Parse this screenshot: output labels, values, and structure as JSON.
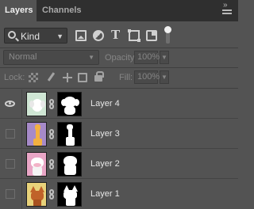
{
  "tabs": [
    {
      "label": "Layers",
      "active": true
    },
    {
      "label": "Channels",
      "active": false
    }
  ],
  "filter": {
    "kind_label": "Kind",
    "icons": [
      "image-filter-icon",
      "adjustment-filter-icon",
      "type-filter-icon",
      "shape-filter-icon",
      "smart-object-filter-icon",
      "filter-toggle-icon"
    ]
  },
  "blend": {
    "mode": "Normal",
    "opacity_label": "Opacity:",
    "opacity_value": "100%"
  },
  "lock": {
    "label": "Lock:",
    "icons": [
      "lock-transparent-icon",
      "lock-pixels-icon",
      "lock-position-icon",
      "lock-artboard-icon",
      "lock-all-icon"
    ],
    "fill_label": "Fill:",
    "fill_value": "100%"
  },
  "layers": [
    {
      "name": "Layer 4",
      "visible": true,
      "thumb_color": "#cfe6d4",
      "thumb_subject": "white dog"
    },
    {
      "name": "Layer 3",
      "visible": false,
      "thumb_color": "#a68ac8",
      "thumb_subject": "giraffe"
    },
    {
      "name": "Layer 2",
      "visible": false,
      "thumb_color": "#e9a6c6",
      "thumb_subject": "cow"
    },
    {
      "name": "Layer 1",
      "visible": false,
      "thumb_color": "#e8d27a",
      "thumb_subject": "fox"
    }
  ],
  "colors": {
    "panel_bg": "#535353",
    "tab_bar_bg": "#2f2f2f",
    "text": "#e6e6e6"
  }
}
